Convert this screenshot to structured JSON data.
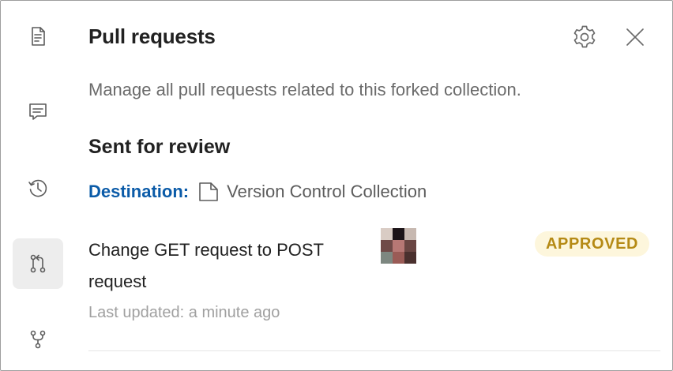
{
  "sidebar": {
    "items": [
      {
        "icon": "document-icon",
        "active": false
      },
      {
        "icon": "comment-icon",
        "active": false
      },
      {
        "icon": "history-icon",
        "active": false
      },
      {
        "icon": "pull-request-icon",
        "active": true
      },
      {
        "icon": "fork-icon",
        "active": false
      }
    ]
  },
  "panel": {
    "title": "Pull requests",
    "description": "Manage all pull requests related to this forked collection.",
    "section_title": "Sent for review",
    "destination_label": "Destination:",
    "destination_name": "Version Control Collection",
    "settings_icon": "gear-icon",
    "close_icon": "close-icon"
  },
  "pull_requests": [
    {
      "title": "Change GET request to POST request",
      "status": "APPROVED",
      "last_updated": "Last updated: a minute ago"
    }
  ],
  "colors": {
    "accent": "#0b5ba8",
    "approved_text": "#b58a15",
    "approved_bg": "#fdf6dc",
    "active_rail_bg": "#ededed"
  },
  "avatar_pixels": [
    "#d9ccc4",
    "#1b1317",
    "#c7b8b0",
    "#6f4a48",
    "#b77875",
    "#6a4643",
    "#7d8780",
    "#9a5b56",
    "#4a302e"
  ]
}
